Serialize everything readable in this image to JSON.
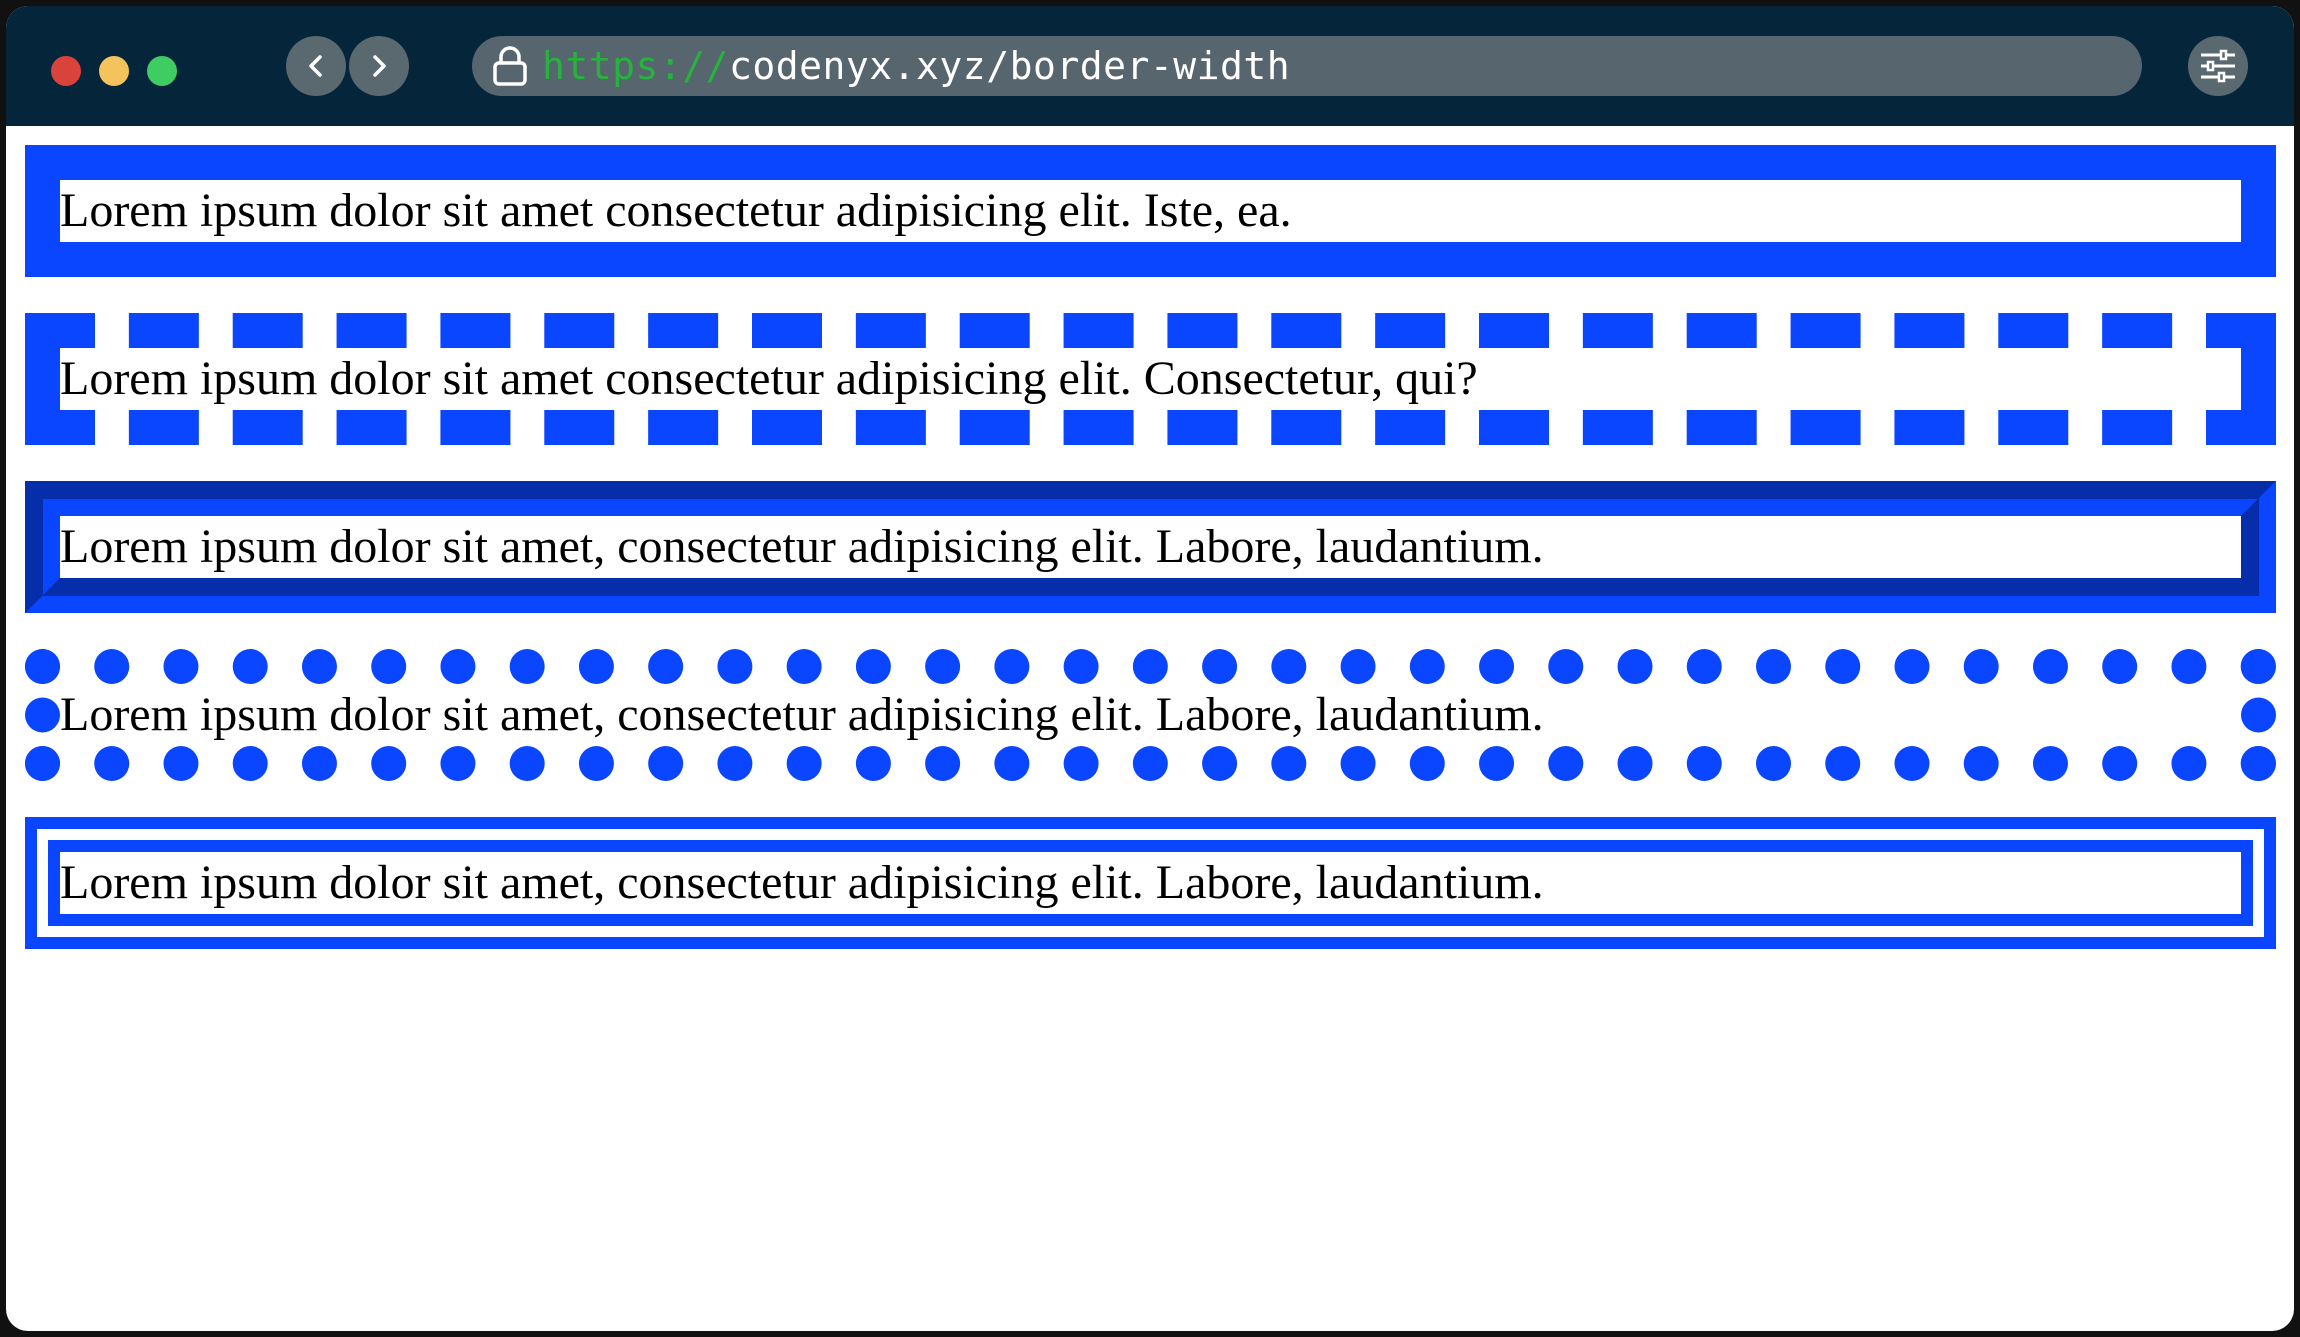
{
  "browser": {
    "url_protocol": "https://",
    "url_rest": "codenyx.xyz/border-width",
    "traffic_lights": [
      "#d9433c",
      "#f4c35b",
      "#3fcc62"
    ]
  },
  "colors": {
    "titlebar": "#05263a",
    "border": "#0a45ff",
    "url_protocol": "#26b23c"
  },
  "icons": {
    "back": "chevron-left-icon",
    "forward": "chevron-right-icon",
    "lock": "lock-icon",
    "settings": "sliders-icon"
  },
  "boxes": [
    {
      "style": "solid",
      "text": "Lorem ipsum dolor sit amet consectetur adipisicing elit. Iste, ea."
    },
    {
      "style": "dashed",
      "text": "Lorem ipsum dolor sit amet consectetur adipisicing elit. Consectetur, qui?"
    },
    {
      "style": "groove",
      "text": "Lorem ipsum dolor sit amet, consectetur adipisicing elit. Labore, laudantium."
    },
    {
      "style": "dotted",
      "text": "Lorem ipsum dolor sit amet, consectetur adipisicing elit. Labore, laudantium."
    },
    {
      "style": "double",
      "text": "Lorem ipsum dolor sit amet, consectetur adipisicing elit. Labore, laudantium."
    }
  ]
}
